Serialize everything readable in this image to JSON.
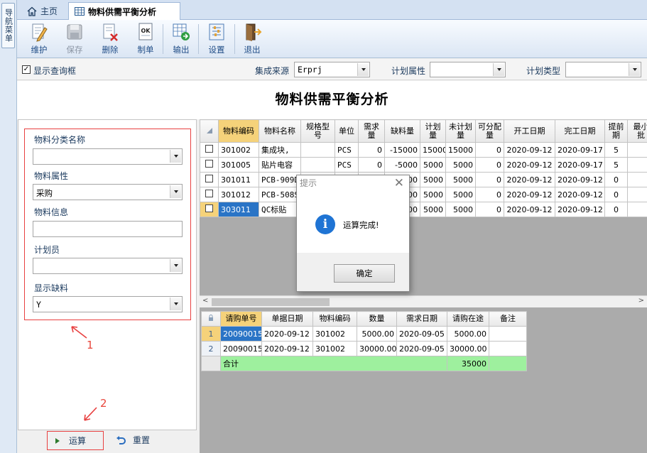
{
  "sidebar": {
    "vertical_tab": "导航菜单"
  },
  "tabs": [
    {
      "label": "主页",
      "icon": "home-icon"
    },
    {
      "label": "物料供需平衡分析",
      "icon": "table-icon"
    }
  ],
  "toolbar": {
    "maintain": "维护",
    "save": "保存",
    "delete": "删除",
    "make_order": "制单",
    "export": "输出",
    "settings": "设置",
    "exit": "退出"
  },
  "filter": {
    "show_query_box": "显示查询框",
    "source_label": "集成来源",
    "source_value": "Erprj",
    "plan_attr_label": "计划属性",
    "plan_attr_value": "",
    "plan_type_label": "计划类型",
    "plan_type_value": ""
  },
  "page_title": "物料供需平衡分析",
  "query_panel": {
    "category_label": "物料分类名称",
    "category_value": "",
    "attr_label": "物料属性",
    "attr_value": "采购",
    "info_label": "物料信息",
    "info_value": "",
    "planner_label": "计划员",
    "planner_value": "",
    "shortage_label": "显示缺料",
    "shortage_value": "Y",
    "annotation_1": "1",
    "annotation_2": "2",
    "run_label": "运算",
    "reset_label": "重置"
  },
  "main_grid": {
    "headers": [
      "物料编码",
      "物料名称",
      "规格型号",
      "单位",
      "需求量",
      "缺料量",
      "计划量",
      "未计划量",
      "可分配量",
      "开工日期",
      "完工日期",
      "提前期",
      "最小批"
    ],
    "rows": [
      [
        "301002",
        "集成块,",
        "",
        "PCS",
        "0",
        "-15000",
        "15000",
        "15000",
        "0",
        "2020-09-12",
        "2020-09-17",
        "5",
        ""
      ],
      [
        "301005",
        "贴片电容",
        "",
        "PCS",
        "0",
        "-5000",
        "5000",
        "5000",
        "0",
        "2020-09-12",
        "2020-09-17",
        "5",
        ""
      ],
      [
        "301011",
        "PCB-909D",
        "",
        "",
        "",
        "000",
        "5000",
        "5000",
        "0",
        "2020-09-12",
        "2020-09-12",
        "0",
        ""
      ],
      [
        "301012",
        "PCB-508S",
        "",
        "",
        "",
        "000",
        "5000",
        "5000",
        "0",
        "2020-09-12",
        "2020-09-12",
        "0",
        ""
      ],
      [
        "303011",
        "QC标贴",
        "",
        "",
        "",
        "000",
        "5000",
        "5000",
        "0",
        "2020-09-12",
        "2020-09-12",
        "0",
        ""
      ]
    ]
  },
  "sub_grid": {
    "headers": [
      "请购单号",
      "单据日期",
      "物料编码",
      "数量",
      "需求日期",
      "请购在途",
      "备注"
    ],
    "rows": [
      [
        "1",
        "20090015",
        "2020-09-12",
        "301002",
        "5000.00",
        "2020-09-05",
        "5000.00",
        ""
      ],
      [
        "2",
        "20090015",
        "2020-09-12",
        "301002",
        "30000.00",
        "2020-09-05",
        "30000.00",
        ""
      ]
    ],
    "total_label": "合计",
    "total_value": "35000"
  },
  "dialog": {
    "title": "提示",
    "message": "运算完成!",
    "ok_label": "确定"
  },
  "colors": {
    "highlight": "#f5d27a",
    "selected": "#2a74c6",
    "total_row": "#9ef09e",
    "annotation": "#e84040"
  }
}
